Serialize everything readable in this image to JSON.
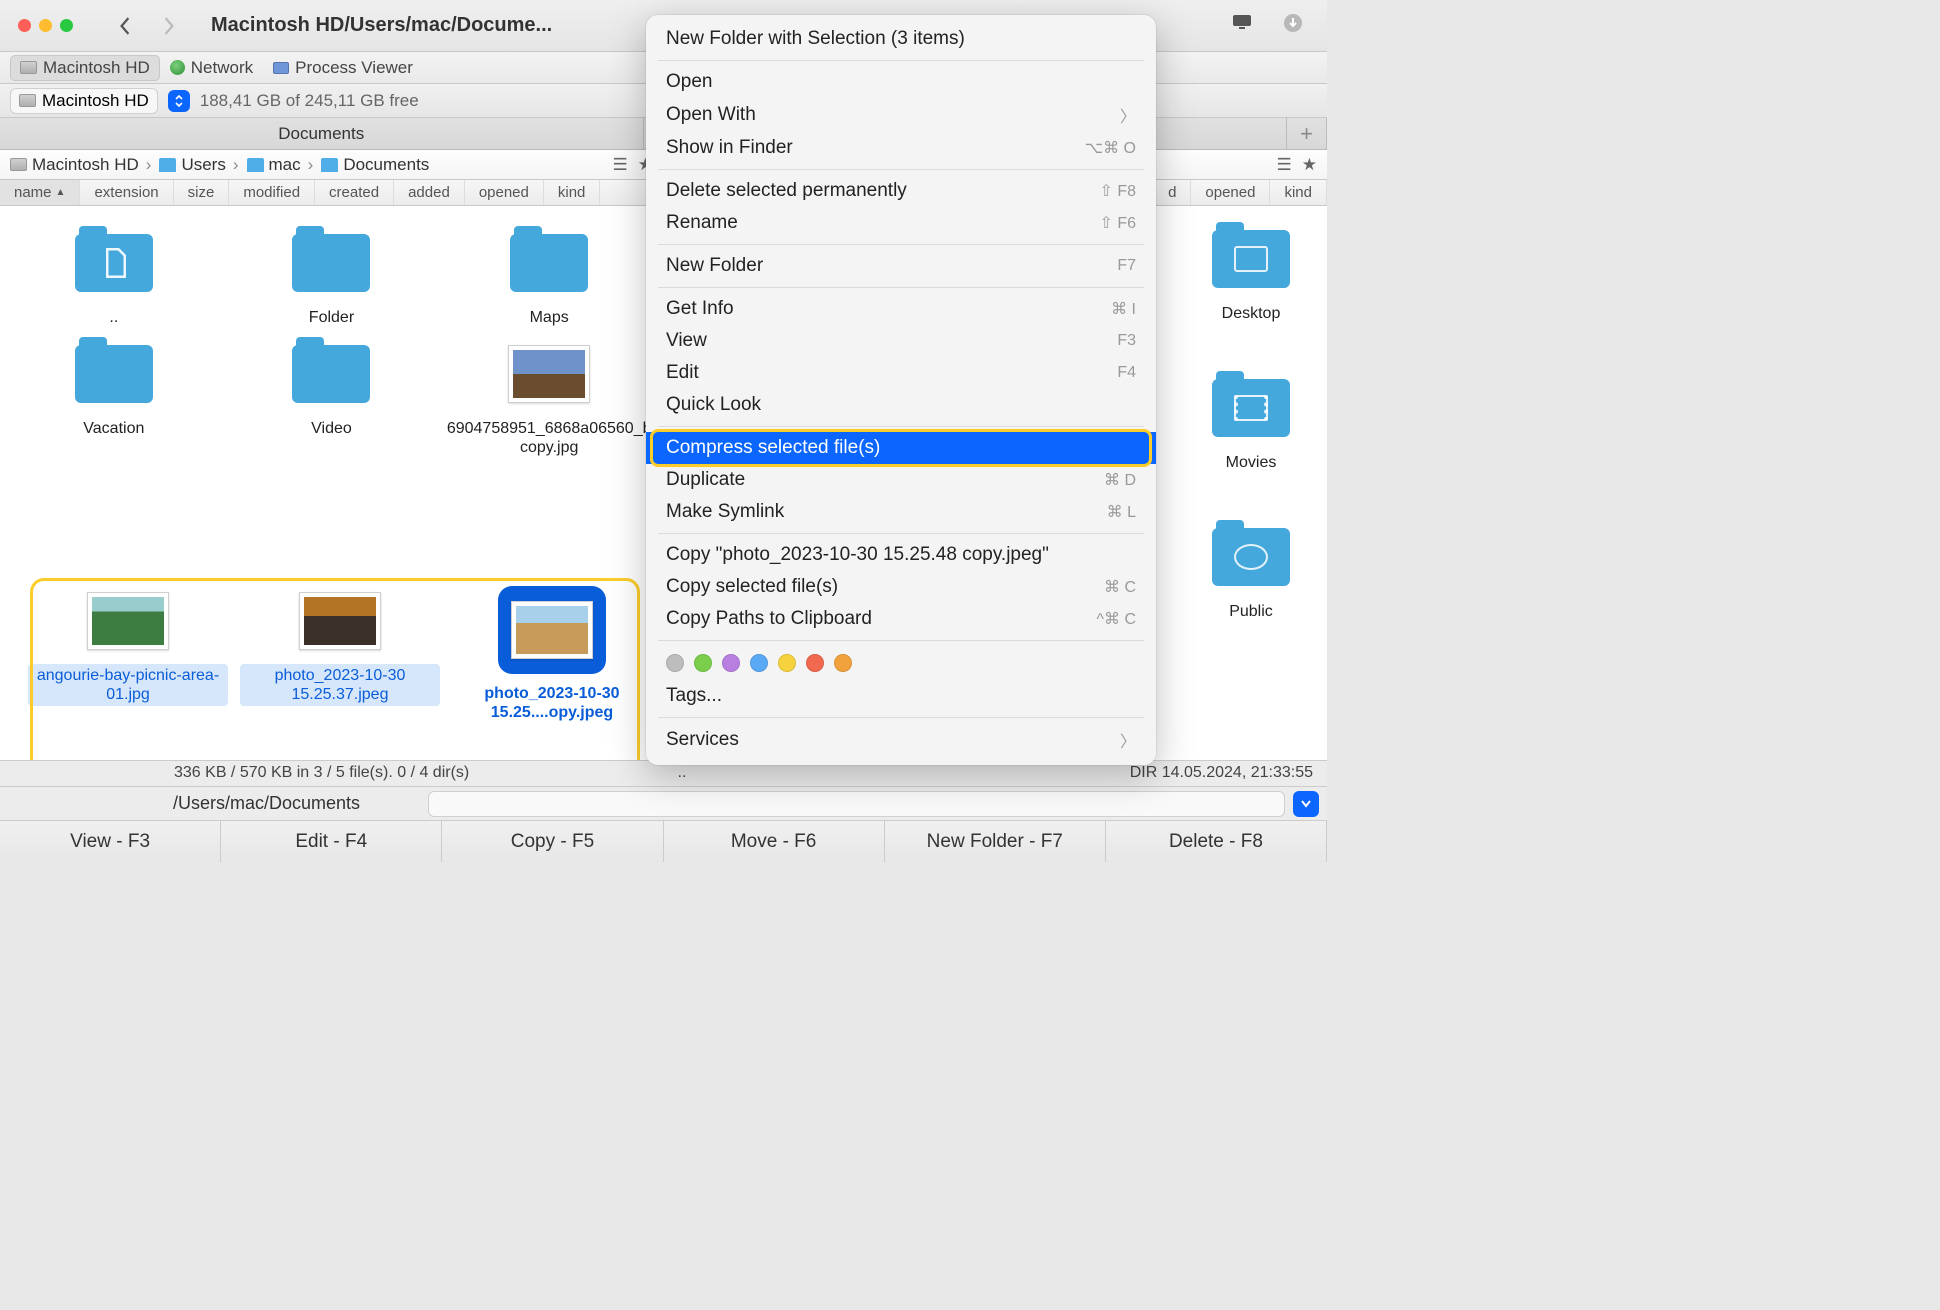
{
  "titlebar": {
    "path": "Macintosh HD/Users/mac/Docume..."
  },
  "favorites": [
    {
      "label": "Macintosh HD",
      "icon": "hd",
      "active": true
    },
    {
      "label": "Network",
      "icon": "globe",
      "active": false
    },
    {
      "label": "Process Viewer",
      "icon": "proc",
      "active": false
    }
  ],
  "volume": {
    "name": "Macintosh HD",
    "free": "188,41 GB of 245,11 GB free"
  },
  "tabs": {
    "left": "Documents",
    "right": ""
  },
  "breadcrumb": [
    "Macintosh HD",
    "Users",
    "mac",
    "Documents"
  ],
  "columns": [
    "name",
    "extension",
    "size",
    "modified",
    "created",
    "added",
    "opened",
    "kind"
  ],
  "left_pane": {
    "row1": [
      {
        "name": "..",
        "type": "folder"
      },
      {
        "name": "Folder",
        "type": "folder"
      },
      {
        "name": "Maps",
        "type": "folder"
      }
    ],
    "row2": [
      {
        "name": "Vacation",
        "type": "folder"
      },
      {
        "name": "Video",
        "type": "folder"
      },
      {
        "name": "6904758951_6868a06560_b copy.jpg",
        "type": "image",
        "variant": "mountain"
      }
    ],
    "selection": [
      {
        "name": "angourie-bay-picnic-area-01.jpg",
        "type": "image",
        "variant": "green",
        "state": "hl"
      },
      {
        "name": "photo_2023-10-30 15.25.37.jpeg",
        "type": "image",
        "variant": "sunset",
        "state": "hl"
      },
      {
        "name": "photo_2023-10-30 15.25....opy.jpeg",
        "type": "image",
        "variant": "beach",
        "state": "sel"
      }
    ]
  },
  "right_pane": {
    "items": [
      {
        "name": "Desktop",
        "type": "folder"
      },
      {
        "name": "Movies",
        "type": "folder"
      },
      {
        "name": "Public",
        "type": "folder"
      }
    ],
    "columns_tail": [
      "d",
      "opened",
      "kind"
    ]
  },
  "context_menu": {
    "groups": [
      [
        {
          "label": "New Folder with Selection (3 items)"
        }
      ],
      [
        {
          "label": "Open"
        },
        {
          "label": "Open With",
          "chevron": true
        },
        {
          "label": "Show in Finder",
          "shortcut": "⌥⌘ O"
        }
      ],
      [
        {
          "label": "Delete selected permanently",
          "shortcut": "⇧ F8"
        },
        {
          "label": "Rename",
          "shortcut": "⇧ F6"
        }
      ],
      [
        {
          "label": "New Folder",
          "shortcut": "F7"
        }
      ],
      [
        {
          "label": "Get Info",
          "shortcut": "⌘ I"
        },
        {
          "label": "View",
          "shortcut": "F3"
        },
        {
          "label": "Edit",
          "shortcut": "F4"
        },
        {
          "label": "Quick Look"
        }
      ],
      [
        {
          "label": "Compress selected file(s)",
          "highlight": true
        },
        {
          "label": "Duplicate",
          "shortcut": "⌘ D"
        },
        {
          "label": "Make Symlink",
          "shortcut": "⌘ L"
        }
      ],
      [
        {
          "label": "Copy \"photo_2023-10-30 15.25.48 copy.jpeg\""
        },
        {
          "label": "Copy selected file(s)",
          "shortcut": "⌘ C"
        },
        {
          "label": "Copy Paths to Clipboard",
          "shortcut": "^⌘ C"
        }
      ]
    ],
    "tag_colors": [
      "#bdbdbd",
      "#7ace4c",
      "#b97fe0",
      "#5aa9f5",
      "#f5d23e",
      "#f1694e",
      "#f2a23d"
    ],
    "tags_label": "Tags...",
    "services_label": "Services"
  },
  "status": {
    "left": "336 KB / 570 KB in 3 / 5 file(s). 0 / 4 dir(s)",
    "right_label": "..",
    "right_meta": "DIR   14.05.2024, 21:33:55"
  },
  "path_input": {
    "label": "/Users/mac/Documents"
  },
  "fnkeys": [
    "View - F3",
    "Edit - F4",
    "Copy - F5",
    "Move - F6",
    "New Folder - F7",
    "Delete - F8"
  ]
}
